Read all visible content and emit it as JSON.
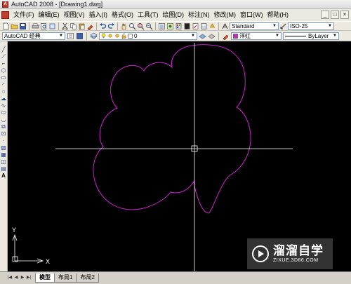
{
  "window": {
    "title": "AutoCAD 2008 - [Drawing1.dwg]"
  },
  "menubar": {
    "items": [
      "文件(F)",
      "编辑(E)",
      "视图(V)",
      "插入(I)",
      "格式(O)",
      "工具(T)",
      "绘图(D)",
      "标注(N)",
      "修改(M)",
      "窗口(W)",
      "帮助(H)"
    ],
    "controls": [
      "_",
      "□",
      "×"
    ]
  },
  "toolbar1": {
    "text_style": "Standard",
    "dim_style": "ISO-25"
  },
  "toolbar2": {
    "workspace": "AutoCAD 经典",
    "layer": "0",
    "color": "洋红",
    "linetype": "ByLayer"
  },
  "canvas": {
    "background": "#000000",
    "curve_color": "#cc22cc",
    "crosshair_color": "#ffffff",
    "ucs": {
      "y_label": "Y",
      "x_label": "X"
    }
  },
  "tabs": {
    "nav": [
      "|◀",
      "◀",
      "▶",
      "▶|"
    ],
    "items": [
      "模型",
      "布局1",
      "布局2"
    ],
    "active": "模型"
  },
  "watermark": {
    "brand": "溜溜自学",
    "url": "ZIXUE.3D66.COM"
  }
}
